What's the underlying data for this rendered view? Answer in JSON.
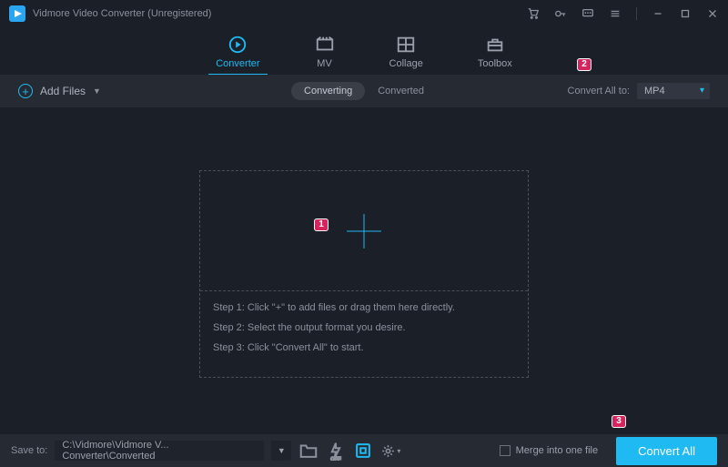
{
  "titlebar": {
    "title": "Vidmore Video Converter (Unregistered)"
  },
  "tabs": {
    "converter": "Converter",
    "mv": "MV",
    "collage": "Collage",
    "toolbox": "Toolbox"
  },
  "toolbar": {
    "add_files": "Add Files",
    "converting": "Converting",
    "converted": "Converted",
    "convert_all_to": "Convert All to:",
    "format": "MP4"
  },
  "dropzone": {
    "step1": "Step 1: Click \"+\" to add files or drag them here directly.",
    "step2": "Step 2: Select the output format you desire.",
    "step3": "Step 3: Click \"Convert All\" to start."
  },
  "bottombar": {
    "save_to": "Save to:",
    "path": "C:\\Vidmore\\Vidmore V... Converter\\Converted",
    "merge": "Merge into one file",
    "convert_all": "Convert All"
  },
  "badges": {
    "b1": "1",
    "b2": "2",
    "b3": "3"
  }
}
